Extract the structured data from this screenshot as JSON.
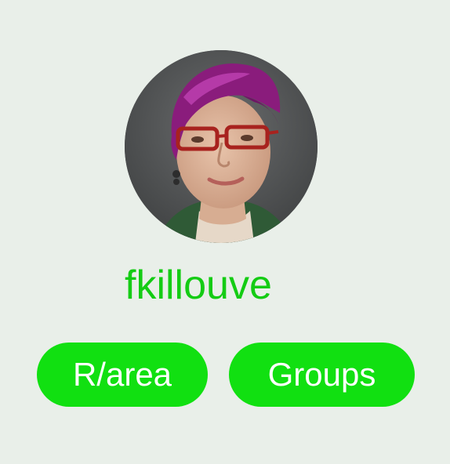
{
  "profile": {
    "username": "fkillouve",
    "avatar": "profile-photo"
  },
  "actions": {
    "rarea_label": "R/area",
    "groups_label": "Groups"
  },
  "colors": {
    "background": "#e9efe9",
    "accent": "#11e011",
    "username_text": "#14cc14",
    "button_text": "#ffffff"
  }
}
